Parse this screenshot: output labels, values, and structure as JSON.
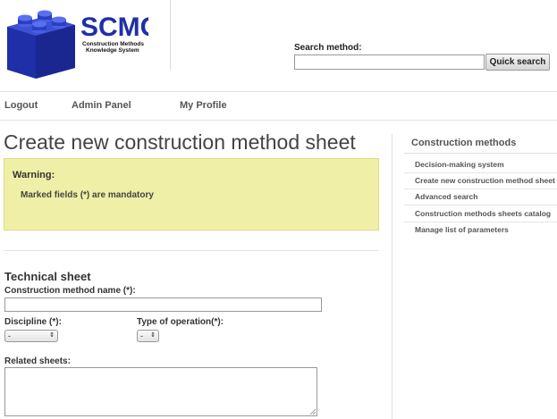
{
  "logo": {
    "title": "SCMC",
    "subtitle_line1": "Construction Methods",
    "subtitle_line2": "Knowledge System",
    "brand_color": "#1f2fa8",
    "brick_color": "#2b3fc4"
  },
  "search": {
    "label": "Search method:",
    "value": "",
    "button_label": "Quick search"
  },
  "nav": {
    "logout": "Logout",
    "admin_panel": "Admin Panel",
    "my_profile": "My Profile"
  },
  "page": {
    "title": "Create new construction method sheet"
  },
  "warning": {
    "title": "Warning:",
    "text": "Marked fields (*) are mandatory",
    "background": "#f0efa7"
  },
  "form": {
    "section_title": "Technical sheet",
    "name_label": "Construction method name (*):",
    "name_value": "",
    "discipline_label": "Discipline (*):",
    "discipline_value": "-",
    "operation_label": "Type of operation(*):",
    "operation_value": "-",
    "related_label": "Related sheets:",
    "related_value": ""
  },
  "sidebar": {
    "title": "Construction methods",
    "items": [
      "Decision-making system",
      "Create new construction method sheet",
      "Advanced search",
      "Construction methods sheets catalog",
      "Manage list of parameters"
    ]
  }
}
